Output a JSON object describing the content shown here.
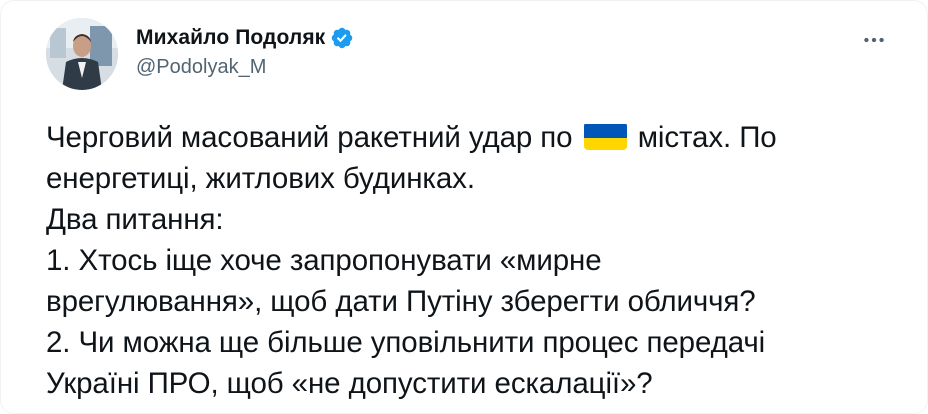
{
  "author": {
    "display_name": "Михайло Подоляк",
    "handle": "@Podolyak_M",
    "verified_icon": "verified-badge-icon"
  },
  "colors": {
    "verified_blue": "#1d9bf0",
    "text": "#0f1419",
    "secondary_text": "#536471",
    "flag_blue": "#0057b7",
    "flag_yellow": "#ffd700"
  },
  "menu": {
    "more_icon": "more-dots-icon"
  },
  "tweet": {
    "line1_before_flag": "Черговий масований ракетний удар по ",
    "flag_emoji_name": "ukraine-flag-icon",
    "line1_after_flag": " містах. По",
    "line2": "енергетиці, житлових будинках.",
    "line3": "Два питання:",
    "line4": "1. Хтось іще хоче запропонувати «мирне",
    "line5": "врегулювання», щоб дати Путіну зберегти обличчя?",
    "line6": "2. Чи можна ще більше уповільнити процес передачі",
    "line7": "Україні ПРО, щоб «не допустити ескалації»?"
  }
}
